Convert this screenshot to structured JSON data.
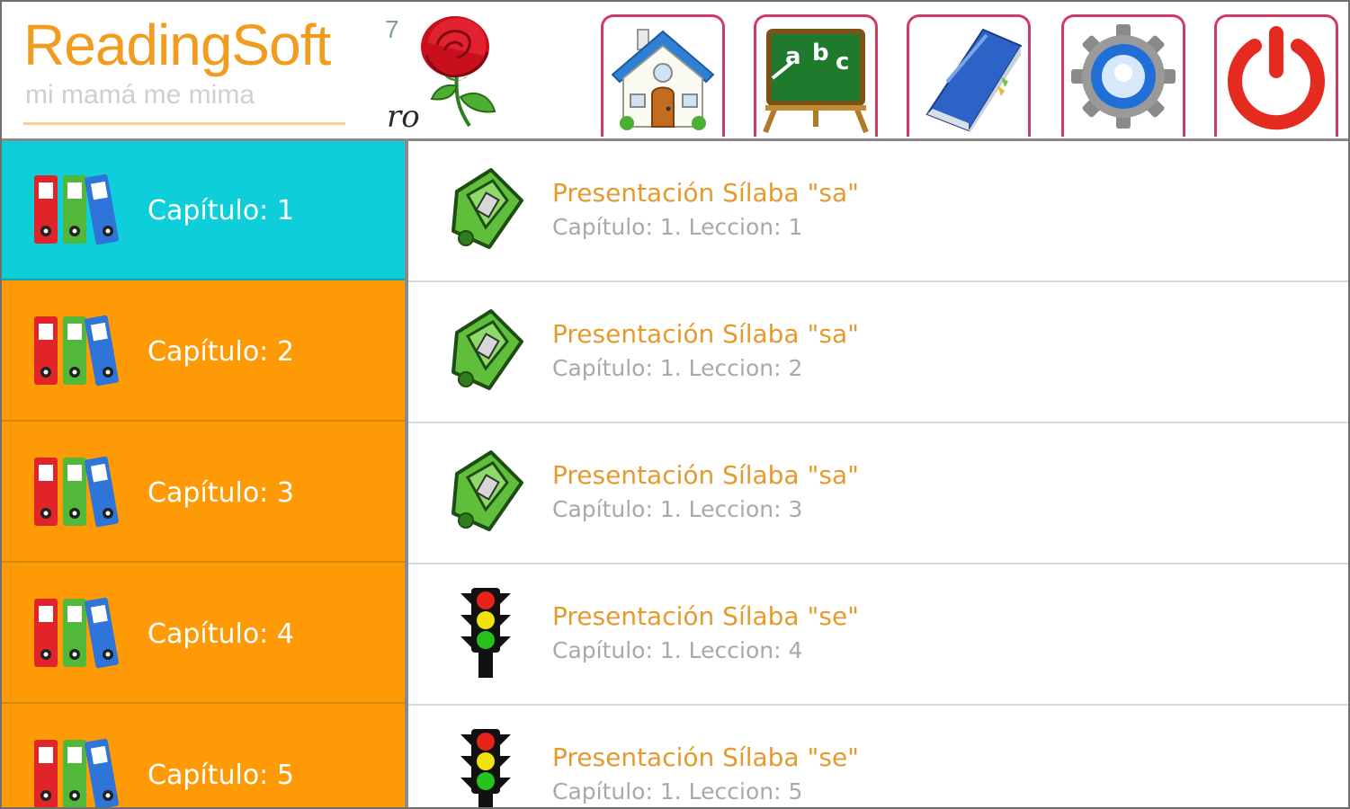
{
  "app": {
    "title": "ReadingSoft",
    "subtitle": "mi mamá me mima"
  },
  "word_card": {
    "number": "7",
    "syllable": "ro",
    "image": "rose-icon"
  },
  "toolbar": {
    "buttons": [
      {
        "name": "home",
        "icon": "house-icon"
      },
      {
        "name": "abc",
        "icon": "chalkboard-abc-icon"
      },
      {
        "name": "book",
        "icon": "book-icon"
      },
      {
        "name": "settings",
        "icon": "gear-icon"
      },
      {
        "name": "power",
        "icon": "power-icon"
      }
    ]
  },
  "sidebar": {
    "items": [
      {
        "label": "Capítulo: 1",
        "active": true
      },
      {
        "label": "Capítulo: 2",
        "active": false
      },
      {
        "label": "Capítulo: 3",
        "active": false
      },
      {
        "label": "Capítulo: 4",
        "active": false
      },
      {
        "label": "Capítulo: 5",
        "active": false
      }
    ]
  },
  "lessons": [
    {
      "title": "Presentación Sílaba \"sa\"",
      "subtitle": "Capítulo: 1. Leccion: 1",
      "icon": "sharpener-icon"
    },
    {
      "title": "Presentación Sílaba \"sa\"",
      "subtitle": "Capítulo: 1. Leccion: 2",
      "icon": "sharpener-icon"
    },
    {
      "title": "Presentación Sílaba \"sa\"",
      "subtitle": "Capítulo: 1. Leccion: 3",
      "icon": "sharpener-icon"
    },
    {
      "title": "Presentación Sílaba \"se\"",
      "subtitle": "Capítulo: 1. Leccion: 4",
      "icon": "traffic-light-icon"
    },
    {
      "title": "Presentación Sílaba \"se\"",
      "subtitle": "Capítulo: 1. Leccion: 5",
      "icon": "traffic-light-icon"
    }
  ],
  "colors": {
    "brand": "#f29c1f",
    "sidebar": "#ff9a07",
    "sidebar_active": "#0ecfd9",
    "button_border": "#cf3b62"
  }
}
